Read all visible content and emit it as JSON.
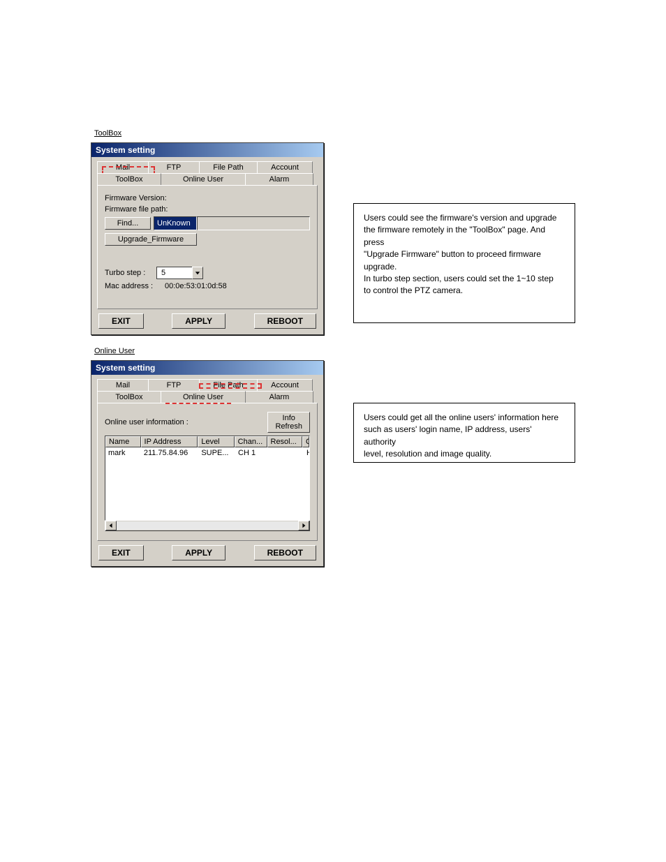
{
  "section1": {
    "title": "ToolBox"
  },
  "section2": {
    "title": "Online User"
  },
  "dialog_title": "System setting",
  "tabs": {
    "mail": "Mail",
    "ftp": "FTP",
    "file_path": "File Path",
    "account": "Account",
    "toolbox": "ToolBox",
    "online_user": "Online User",
    "alarm": "Alarm"
  },
  "toolbox": {
    "fw_version_label": "Firmware Version:",
    "fw_file_path_label": "Firmware file path:",
    "find_btn": "Find...",
    "find_value": "UnKnown",
    "upgrade_btn": "Upgrade_Firmware",
    "turbo_label": "Turbo step :",
    "turbo_value": "5",
    "mac_label": "Mac address :",
    "mac_value": "00:0e:53:01:0d:58"
  },
  "online": {
    "info_label": "Online user information :",
    "info_refresh_btn": "Info\nRefresh",
    "columns": {
      "name": "Name",
      "ip": "IP Address",
      "level": "Level",
      "chan": "Chan...",
      "resol": "Resol...",
      "qua": "Qua"
    },
    "rows": [
      {
        "name": "mark",
        "ip": "211.75.84.96",
        "level": "SUPE...",
        "chan": "CH 1",
        "resol": "",
        "qua": "HIG"
      }
    ]
  },
  "footer": {
    "exit": "EXIT",
    "apply": "APPLY",
    "reboot": "REBOOT"
  },
  "desc1": {
    "line1": "Users could see the firmware's version and upgrade",
    "line2a": "the firmware remotely in the ",
    "line2q1": "\"",
    "line2b": "ToolBox",
    "line2q2": "\"",
    "line2c": " page. And press",
    "line3q1": "\"",
    "line3a": "Upgrade Firmware",
    "line3q2": "\"",
    "line3b": " button to proceed firmware",
    "line4": "upgrade.",
    "line5": "In turbo step section, users could set the 1~10 step",
    "line6": "to control the PTZ camera."
  },
  "desc2": {
    "line1": "Users could get all the online users' information here",
    "line2a": "such as users' login name, IP address, users' authority",
    "line3": "level, resolution and image quality."
  }
}
